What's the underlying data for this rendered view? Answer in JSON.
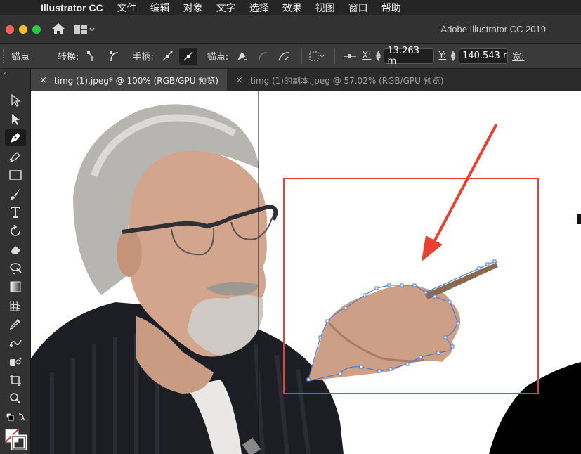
{
  "menubar": {
    "app_name": "Illustrator CC",
    "items": [
      "文件",
      "编辑",
      "对象",
      "文字",
      "选择",
      "效果",
      "视图",
      "窗口",
      "帮助"
    ]
  },
  "titlebar": {
    "title": "Adobe Illustrator CC 2019"
  },
  "control_bar": {
    "selection_label": "锚点",
    "convert_label": "转换:",
    "handles_label": "手柄:",
    "anchors_label": "锚点:",
    "x_label": "X:",
    "x_value": "13.263 m",
    "y_label": "Y:",
    "y_value": "140.543 n",
    "width_label": "宽:"
  },
  "tabs": [
    {
      "label": "timg (1).jpeg* @ 100% (RGB/GPU 预览)",
      "active": true
    },
    {
      "label": "timg (1)的副本.jpeg @ 57.02% (RGB/GPU 预览)",
      "active": false
    }
  ],
  "tools": [
    "selection-tool",
    "direct-selection-tool",
    "pen-tool",
    "curvature-tool",
    "rectangle-tool",
    "paintbrush-tool",
    "type-tool",
    "rotate-tool",
    "eraser-tool",
    "lasso-tool",
    "gradient-tool",
    "mesh-tool",
    "eyedropper-tool",
    "blend-tool",
    "symbol-sprayer-tool",
    "artboard-tool",
    "zoom-tool",
    "default-colors",
    "fill-stroke-swatch"
  ],
  "annotation_color": "#e8412f",
  "selection_path_color": "#4a7bd8"
}
